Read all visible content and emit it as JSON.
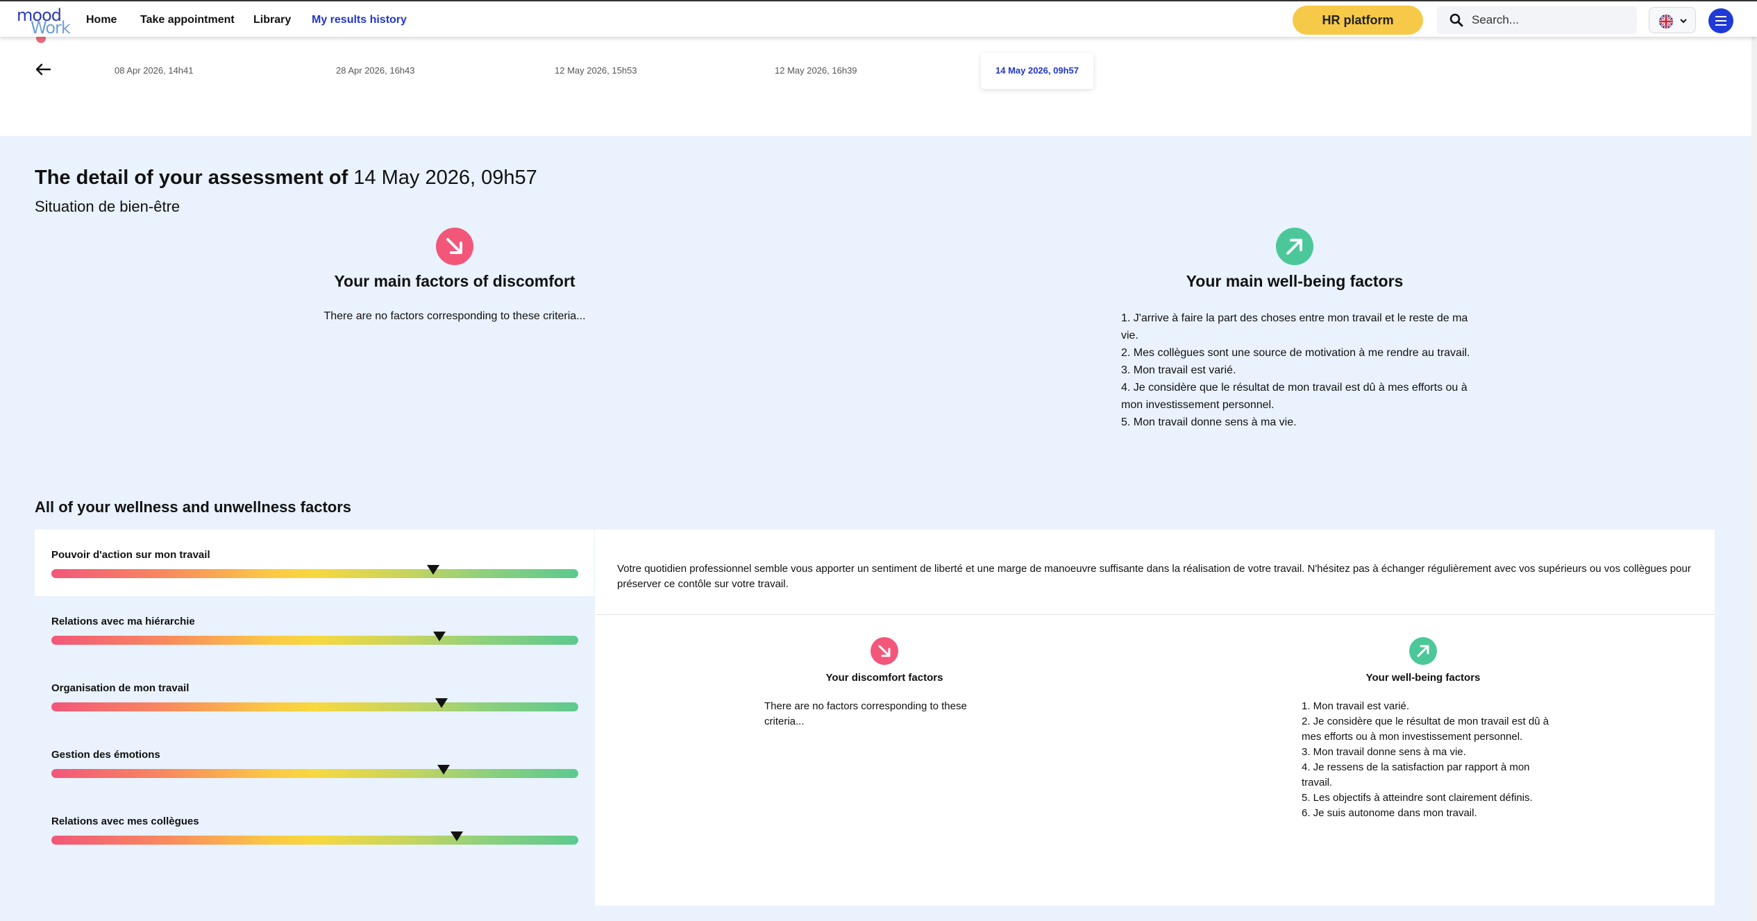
{
  "nav": {
    "logo_top": "mood",
    "logo_bottom": "Work",
    "links": [
      "Home",
      "Take appointment",
      "Library",
      "My results history"
    ],
    "hr_button": "HR platform",
    "search_placeholder": "Search..."
  },
  "history": {
    "dates": [
      "08 Apr 2026, 14h41",
      "28 Apr 2026, 16h43",
      "12 May 2026, 15h53",
      "12 May 2026, 16h39"
    ],
    "active_date": "14 May 2026, 09h57"
  },
  "assessment": {
    "title_prefix": "The detail of your assessment of",
    "title_date": "14 May 2026, 09h57",
    "subtitle": "Situation de bien-être",
    "discomfort_title": "Your main factors of discomfort",
    "discomfort_empty": "There are no factors corresponding to these criteria...",
    "wellbeing_title": "Your main well-being factors",
    "wellbeing_items": [
      "1. J'arrive à faire la part des choses entre mon travail et le reste de ma vie.",
      "2. Mes collègues sont une source de motivation à me rendre au travail.",
      "3. Mon travail est varié.",
      "4. Je considère que le résultat de mon travail est dû à mes efforts ou à mon investissement personnel.",
      "5. Mon travail donne sens à ma vie."
    ]
  },
  "factors": {
    "title": "All of your wellness and unwellness factors",
    "items": [
      {
        "label": "Pouvoir d'action sur mon travail",
        "level": 0.725
      },
      {
        "label": "Relations avec ma hiérarchie",
        "level": 0.737
      },
      {
        "label": "Organisation de mon travail",
        "level": 0.74
      },
      {
        "label": "Gestion des émotions",
        "level": 0.745
      },
      {
        "label": "Relations avec mes collègues",
        "level": 0.77
      }
    ]
  },
  "detail": {
    "text": "Votre quotidien professionnel semble vous apporter un sentiment de liberté et une marge de manoeuvre suffisante dans la réalisation de votre travail. N'hésitez pas à échanger régulièrement avec vos supérieurs ou vos collègues pour préserver ce contôle sur votre travail.",
    "discomfort_title": "Your discomfort factors",
    "discomfort_empty": "There are no factors corresponding to these criteria...",
    "wellbeing_title": "Your well-being factors",
    "wellbeing_items": [
      "1. Mon travail est varié.",
      "2. Je considère que le résultat de mon travail est dû à mes efforts ou à mon investissement personnel.",
      "3. Mon travail donne sens à ma vie.",
      "4. Je ressens de la satisfaction par rapport à mon travail.",
      "5. Les objectifs à atteindre sont clairement définis.",
      "6. Je suis autonome dans mon travail."
    ]
  },
  "colors": {
    "accent": "#2236c9",
    "hr_button": "#f7c948",
    "discomfort": "#f2577a",
    "wellbeing": "#4cc79a",
    "section_bg": "#e9f2fd"
  },
  "icons": [
    "search-icon",
    "flag-uk-icon",
    "chevron-down-icon",
    "menu-icon",
    "arrow-left-icon",
    "arrow-down-right-icon",
    "arrow-up-right-icon",
    "marker-triangle-icon"
  ]
}
